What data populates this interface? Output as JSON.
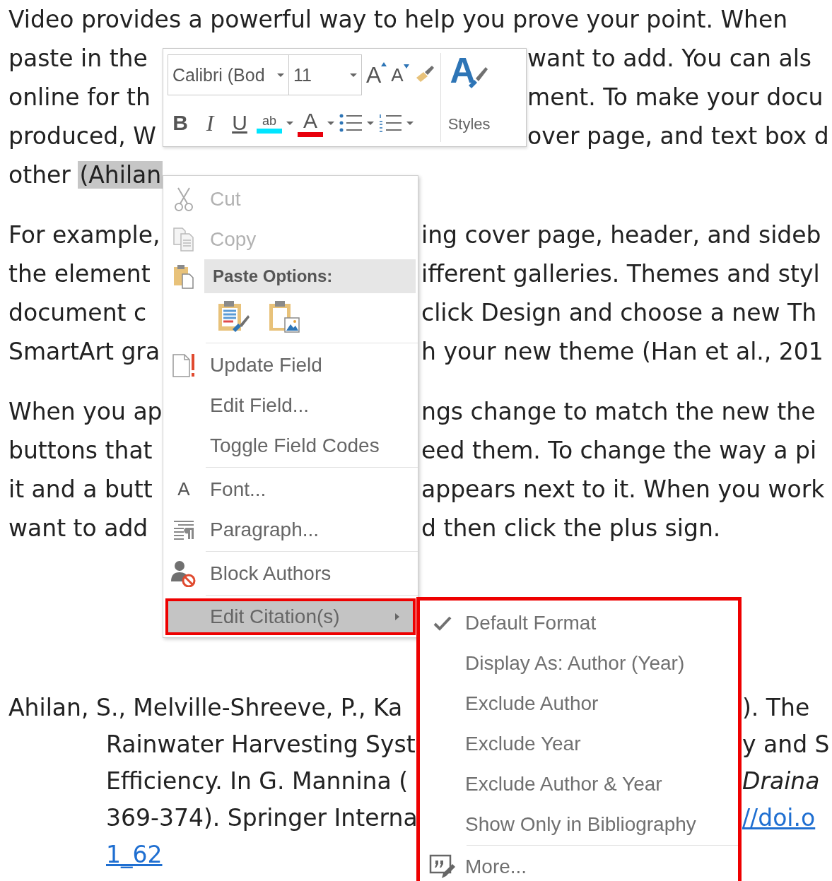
{
  "document": {
    "paragraphs": [
      {
        "kind": "body",
        "lines": [
          {
            "left": "Video provides a powerful way to help you prove your point. When"
          },
          {
            "left": "paste in the",
            "right": "want to add. You can als"
          },
          {
            "left": "online for th",
            "right": "ment. To make your docu"
          },
          {
            "left": "produced, W",
            "right": "over page, and text box d"
          },
          {
            "left": "other ",
            "selection": "(Ahilan"
          }
        ]
      },
      {
        "kind": "body",
        "lines": [
          {
            "left": "For example,",
            "right": "ing cover page, header, and sideb"
          },
          {
            "left": "the element",
            "right": "ifferent galleries. Themes and styl"
          },
          {
            "left": "document c",
            "right": "click Design and choose a new Th"
          },
          {
            "left": "SmartArt gra",
            "right": "h your new theme (Han et al., 201"
          }
        ]
      },
      {
        "kind": "body",
        "lines": [
          {
            "left": "When you ap",
            "right": "ngs change to match the new the"
          },
          {
            "left": "buttons that",
            "right": "eed them. To change the way a pi"
          },
          {
            "left": "it and a butt",
            "right": "appears next to it. When you work"
          },
          {
            "left": "want to add",
            "right": "d then click the plus sign."
          }
        ]
      },
      {
        "kind": "reference",
        "lines": [
          {
            "left": "Ahilan, S., Melville-Shreeve, P., Ka",
            "right": "). The"
          },
          {
            "left": "Rainwater Harvesting Syst",
            "right": "y and S"
          },
          {
            "left": "Efficiency. In G. Mannina (",
            "right": "Draina",
            "right_italic": true
          },
          {
            "left": "369-374). Springer Interna",
            "right": "//doi.o",
            "right_link": true
          },
          {
            "left": "1_62",
            "left_link": true
          }
        ]
      }
    ]
  },
  "mini_toolbar": {
    "font": "Calibri (Bod",
    "size": "11",
    "grow_glyph": "A",
    "shrink_glyph": "A",
    "bold": "B",
    "italic": "I",
    "underline": "U",
    "highlight_glyph": "ab",
    "font_color_glyph": "A",
    "styles_glyph": "A",
    "styles_label": "Styles"
  },
  "context_menu": {
    "items": [
      {
        "kind": "command",
        "label": "Cut",
        "disabled": true,
        "selected": false
      },
      {
        "kind": "command",
        "label": "Copy",
        "disabled": true,
        "selected": false
      },
      {
        "kind": "header",
        "label": "Paste Options:"
      },
      {
        "kind": "paste_buttons"
      },
      {
        "kind": "separator"
      },
      {
        "kind": "command",
        "label": "Update Field",
        "disabled": false,
        "selected": false
      },
      {
        "kind": "command",
        "label": "Edit Field...",
        "disabled": false,
        "selected": false
      },
      {
        "kind": "command",
        "label": "Toggle Field Codes",
        "disabled": false,
        "selected": false
      },
      {
        "kind": "separator"
      },
      {
        "kind": "command",
        "label": "Font...",
        "icon_glyph": "A",
        "disabled": false,
        "selected": false
      },
      {
        "kind": "command",
        "label": "Paragraph...",
        "disabled": false,
        "selected": false
      },
      {
        "kind": "separator"
      },
      {
        "kind": "command",
        "label": "Block Authors",
        "disabled": false,
        "selected": false
      },
      {
        "kind": "separator"
      },
      {
        "kind": "submenu",
        "label": "Edit Citation(s)",
        "disabled": false,
        "selected": true
      }
    ]
  },
  "submenu": {
    "items": [
      {
        "kind": "option",
        "label": "Default Format",
        "checked": true
      },
      {
        "kind": "option",
        "label": "Display As: Author (Year)",
        "checked": false
      },
      {
        "kind": "option",
        "label": "Exclude Author",
        "checked": false
      },
      {
        "kind": "option",
        "label": "Exclude Year",
        "checked": false
      },
      {
        "kind": "option",
        "label": "Exclude Author & Year",
        "checked": false
      },
      {
        "kind": "option",
        "label": "Show Only in Bibliography",
        "checked": false
      },
      {
        "kind": "separator"
      },
      {
        "kind": "command",
        "label": "More..."
      }
    ]
  }
}
